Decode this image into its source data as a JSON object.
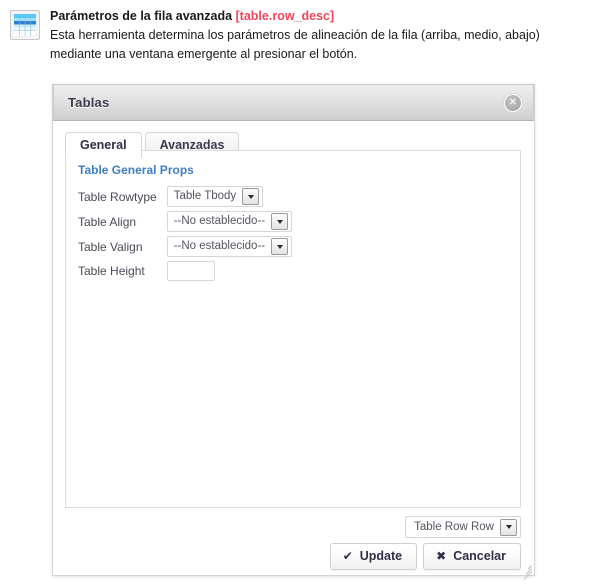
{
  "help": {
    "icon": "table-row-properties-icon",
    "title": "Parámetros de la fila avanzada",
    "key": "[table.row_desc]",
    "description": "Esta herramienta determina los parámetros de alineación de la fila (arriba, medio, abajo) mediante una ventana emergente al presionar el botón."
  },
  "dialog": {
    "title": "Tablas",
    "close_icon": "close-icon",
    "tabs": [
      {
        "label": "General",
        "active": true
      },
      {
        "label": "Avanzadas",
        "active": false
      }
    ],
    "panel": {
      "heading": "Table General Props",
      "fields": [
        {
          "label": "Table Rowtype",
          "type": "select",
          "value": "Table Tbody"
        },
        {
          "label": "Table Align",
          "type": "select",
          "value": "--No establecido--"
        },
        {
          "label": "Table Valign",
          "type": "select",
          "value": "--No establecido--"
        },
        {
          "label": "Table Height",
          "type": "text",
          "value": "",
          "placeholder": ""
        }
      ]
    },
    "footer": {
      "scope_select": "Table Row Row",
      "update_label": "Update",
      "update_glyph": "✔",
      "cancel_label": "Cancelar",
      "cancel_glyph": "✖",
      "resize_grip": "resize-grip-icon"
    }
  },
  "colors": {
    "accent_red": "#f0475b",
    "heading_blue": "#3f7fc1",
    "title_text": "#3b3b4f"
  }
}
